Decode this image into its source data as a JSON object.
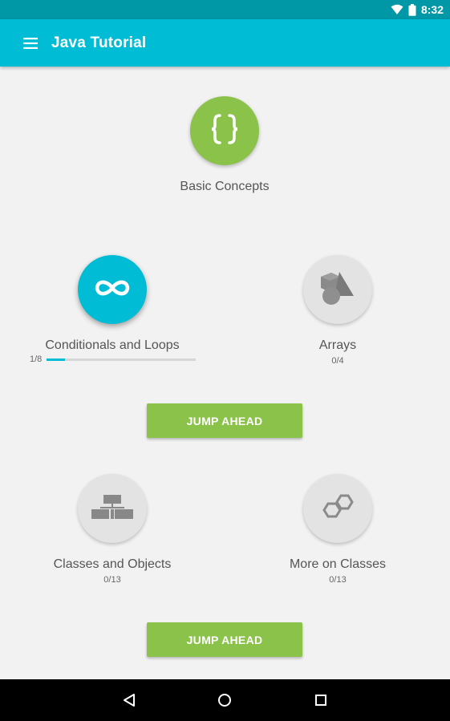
{
  "status_bar": {
    "time": "8:32",
    "icons": [
      "wifi-icon",
      "battery-icon"
    ]
  },
  "app_bar": {
    "title": "Java Tutorial",
    "menu_icon": "hamburger-menu-icon"
  },
  "modules": {
    "basic_concepts": {
      "label": "Basic Concepts",
      "icon": "curly-braces-icon"
    },
    "conditionals_loops": {
      "label": "Conditionals and Loops",
      "progress_text": "1/8",
      "progress": 0.125,
      "icon": "infinity-icon"
    },
    "arrays": {
      "label": "Arrays",
      "progress_text": "0/4",
      "icon": "shapes-icon"
    },
    "classes_objects": {
      "label": "Classes and Objects",
      "progress_text": "0/13",
      "icon": "hierarchy-icon"
    },
    "more_on_classes": {
      "label": "More on Classes",
      "progress_text": "0/13",
      "icon": "hexagons-icon"
    }
  },
  "buttons": {
    "jump_ahead_1": "JUMP AHEAD",
    "jump_ahead_2": "JUMP AHEAD"
  },
  "colors": {
    "primary": "#00bcd4",
    "primary_dark": "#0097a7",
    "accent_green": "#8bc34a",
    "locked_grey": "#e3e3e3"
  },
  "nav_bar": {
    "icons": [
      "back-icon",
      "home-icon",
      "recents-icon"
    ]
  }
}
